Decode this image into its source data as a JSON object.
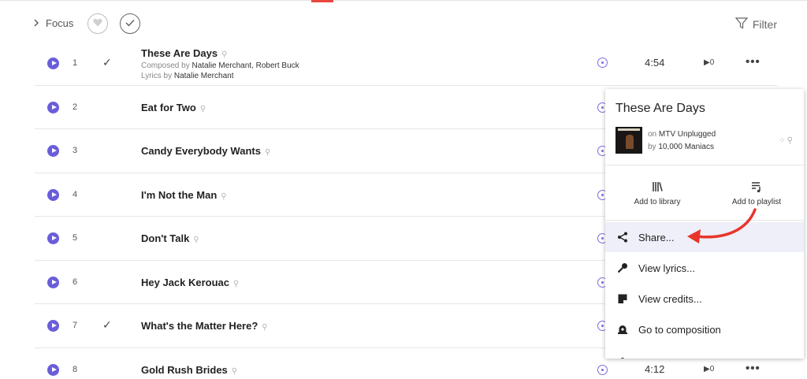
{
  "toolbar": {
    "focus_label": "Focus",
    "filter_label": "Filter"
  },
  "tracks": [
    {
      "num": "1",
      "title": "These Are Days",
      "owned": true,
      "composed_prefix": "Composed by",
      "composers": "Natalie Merchant, Robert Buck",
      "lyrics_prefix": "Lyrics by",
      "lyricist": "Natalie Merchant",
      "duration": "4:54",
      "plays": "0"
    },
    {
      "num": "2",
      "title": "Eat for Two",
      "owned": false
    },
    {
      "num": "3",
      "title": "Candy Everybody Wants",
      "owned": false
    },
    {
      "num": "4",
      "title": "I'm Not the Man",
      "owned": false
    },
    {
      "num": "5",
      "title": "Don't Talk",
      "owned": false
    },
    {
      "num": "6",
      "title": "Hey Jack Kerouac",
      "owned": false
    },
    {
      "num": "7",
      "title": "What's the Matter Here?",
      "owned": true
    },
    {
      "num": "8",
      "title": "Gold Rush Brides",
      "owned": false,
      "duration": "4:12",
      "plays": "0"
    }
  ],
  "popup": {
    "title": "These Are Days",
    "album_prefix": "on",
    "album": "MTV Unplugged",
    "artist_prefix": "by",
    "artist": "10,000 Maniacs",
    "add_library": "Add to library",
    "add_playlist": "Add to playlist",
    "menu": [
      {
        "label": "Share...",
        "icon": "share-icon",
        "highlighted": true
      },
      {
        "label": "View lyrics...",
        "icon": "microphone-icon"
      },
      {
        "label": "View credits...",
        "icon": "credits-book-icon"
      },
      {
        "label": "Go to composition",
        "icon": "composition-icon"
      }
    ]
  },
  "colors": {
    "play": "#6a5ddb",
    "accent": "#e8463f",
    "highlight": "#eeeff8",
    "annotation_arrow": "#e8352b"
  }
}
